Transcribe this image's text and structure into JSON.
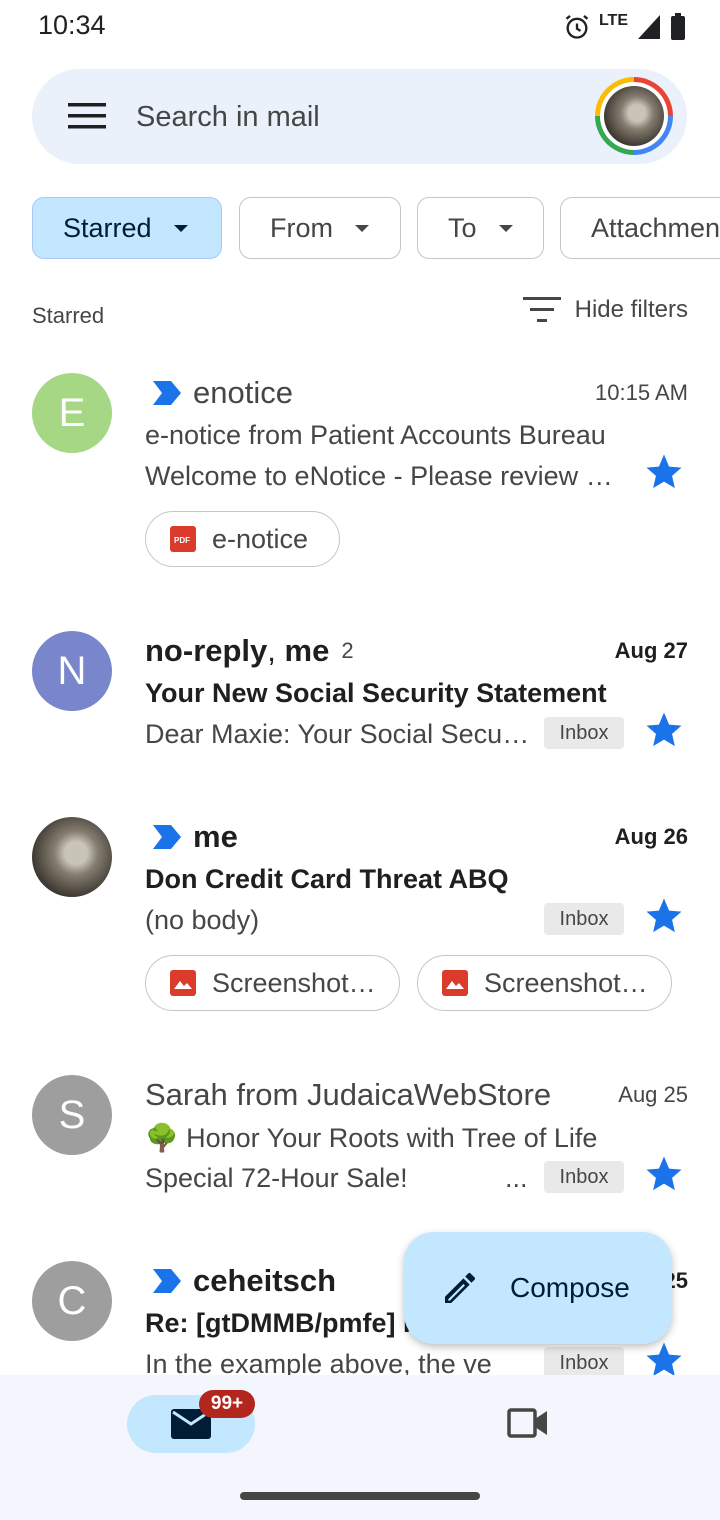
{
  "status_bar": {
    "time": "10:34",
    "network": "LTE"
  },
  "search": {
    "placeholder": "Search in mail"
  },
  "filters": {
    "chips": [
      {
        "label": "Starred",
        "active": true
      },
      {
        "label": "From",
        "active": false
      },
      {
        "label": "To",
        "active": false
      },
      {
        "label": "Attachment",
        "active": false
      }
    ],
    "section_label": "Starred",
    "hide_filters_label": "Hide filters"
  },
  "mails": [
    {
      "sender": "enotice",
      "avatar_letter": "E",
      "avatar_color": "#a5d785",
      "time": "10:15 AM",
      "important": true,
      "unread": false,
      "subject": "e-notice from Patient Accounts Bureau",
      "snippet": "Welcome to eNotice - Please review your notice",
      "starred": true,
      "attachments": [
        {
          "name": "e-notice",
          "type": "pdf"
        }
      ]
    },
    {
      "sender_primary": "no-reply",
      "sender_secondary": "me",
      "count": "2",
      "avatar_letter": "N",
      "avatar_color": "#7986cb",
      "time": "Aug 27",
      "unread": true,
      "subject": "Your New Social Security Statement",
      "snippet": "Dear Maxie: Your Social Security Statement",
      "label": "Inbox",
      "starred": true
    },
    {
      "sender": "me",
      "avatar_photo": true,
      "important": true,
      "unread": true,
      "time": "Aug 26",
      "subject": "Don Credit Card Threat ABQ",
      "snippet": "(no body)",
      "label": "Inbox",
      "starred": true,
      "attachments": [
        {
          "name": "Screenshot_20230826.png",
          "type": "image"
        },
        {
          "name": "Screenshot_20230826.png",
          "type": "image"
        }
      ]
    },
    {
      "sender": "Sarah from JudaicaWebStore",
      "avatar_letter": "S",
      "avatar_color": "#9e9e9e",
      "time": "Aug 25",
      "unread": false,
      "subject": "🌳 Honor Your Roots with Tree of Life",
      "snippet": "Special 72-Hour Sale!",
      "snippet_more": "...",
      "label": "Inbox",
      "starred": true
    },
    {
      "sender": "ceheitsch",
      "avatar_letter": "C",
      "avatar_color": "#9e9e9e",
      "time": "Aug 25",
      "important": true,
      "unread": true,
      "subject": "Re: [gtDMMB/pmfe] Issue",
      "snippet": "In the example above, the ve",
      "label": "Inbox",
      "starred": true
    }
  ],
  "compose": {
    "label": "Compose"
  },
  "bottom_nav": {
    "mail_badge": "99+"
  },
  "colors": {
    "accent": "#0b57d0",
    "chip_active": "#c2e7ff",
    "star": "#1a73e8",
    "badge": "#b3261e"
  }
}
